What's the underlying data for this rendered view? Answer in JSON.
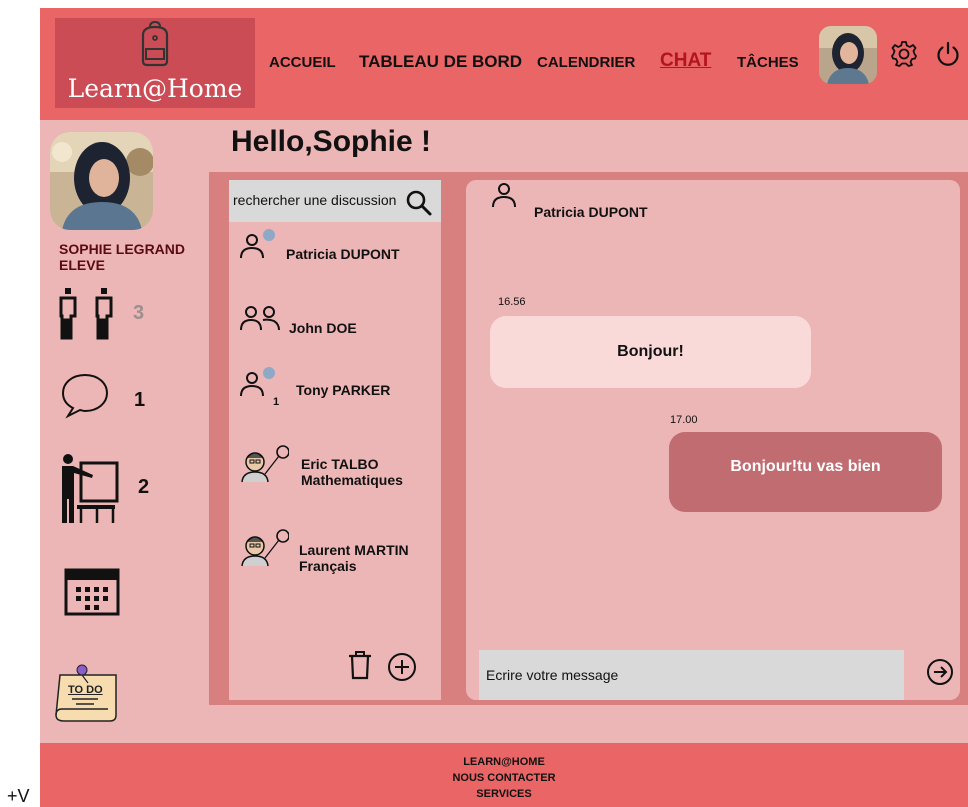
{
  "app": {
    "logo_text": "Learn@Home"
  },
  "nav": {
    "items": [
      {
        "label": "ACCUEIL"
      },
      {
        "label": "TABLEAU DE BORD"
      },
      {
        "label": "CALENDRIER"
      },
      {
        "label": "CHAT",
        "active": true
      },
      {
        "label": "TÂCHES"
      }
    ]
  },
  "header_icons": [
    "user-avatar",
    "gear-icon",
    "power-icon"
  ],
  "greeting": "Hello,Sophie !",
  "profile": {
    "name": "SOPHIE  LEGRAND",
    "role": "ELEVE"
  },
  "sidebar": {
    "classmates_count": "3",
    "messages_count": "1",
    "classes_count": "2",
    "todo_label": "TO DO"
  },
  "search": {
    "placeholder": "rechercher une discussion"
  },
  "contacts": [
    {
      "name": "Patricia DUPONT",
      "subtitle": "",
      "icon": "user-icon",
      "online": true,
      "unread": ""
    },
    {
      "name": "John DOE",
      "subtitle": "",
      "icon": "group-icon",
      "online": false,
      "unread": ""
    },
    {
      "name": "Tony PARKER",
      "subtitle": "",
      "icon": "user-icon",
      "online": true,
      "unread": "1"
    },
    {
      "name": "Eric TALBO",
      "subtitle": "Mathematiques",
      "icon": "teacher-icon",
      "online": false,
      "unread": ""
    },
    {
      "name": "Laurent  MARTIN",
      "subtitle": "Français",
      "icon": "teacher-icon",
      "online": false,
      "unread": ""
    }
  ],
  "chat": {
    "recipient": "Patricia DUPONT",
    "messages": [
      {
        "time": "16.56",
        "text": "Bonjour!",
        "direction": "incoming"
      },
      {
        "time": "17.00",
        "text": "Bonjour!tu vas bien",
        "direction": "outgoing"
      }
    ],
    "input_placeholder": "Ecrire votre message"
  },
  "footer": {
    "lines": [
      "LEARN@HOME",
      "NOUS CONTACTER",
      "SERVICES"
    ]
  },
  "corner_text": "+V",
  "colors": {
    "header": "#e96566",
    "page_bg": "#edb6b6",
    "panel": "#d87f80",
    "active_nav": "#b3141f",
    "bubble_in": "#fad9d9",
    "bubble_out": "#c06c71"
  }
}
